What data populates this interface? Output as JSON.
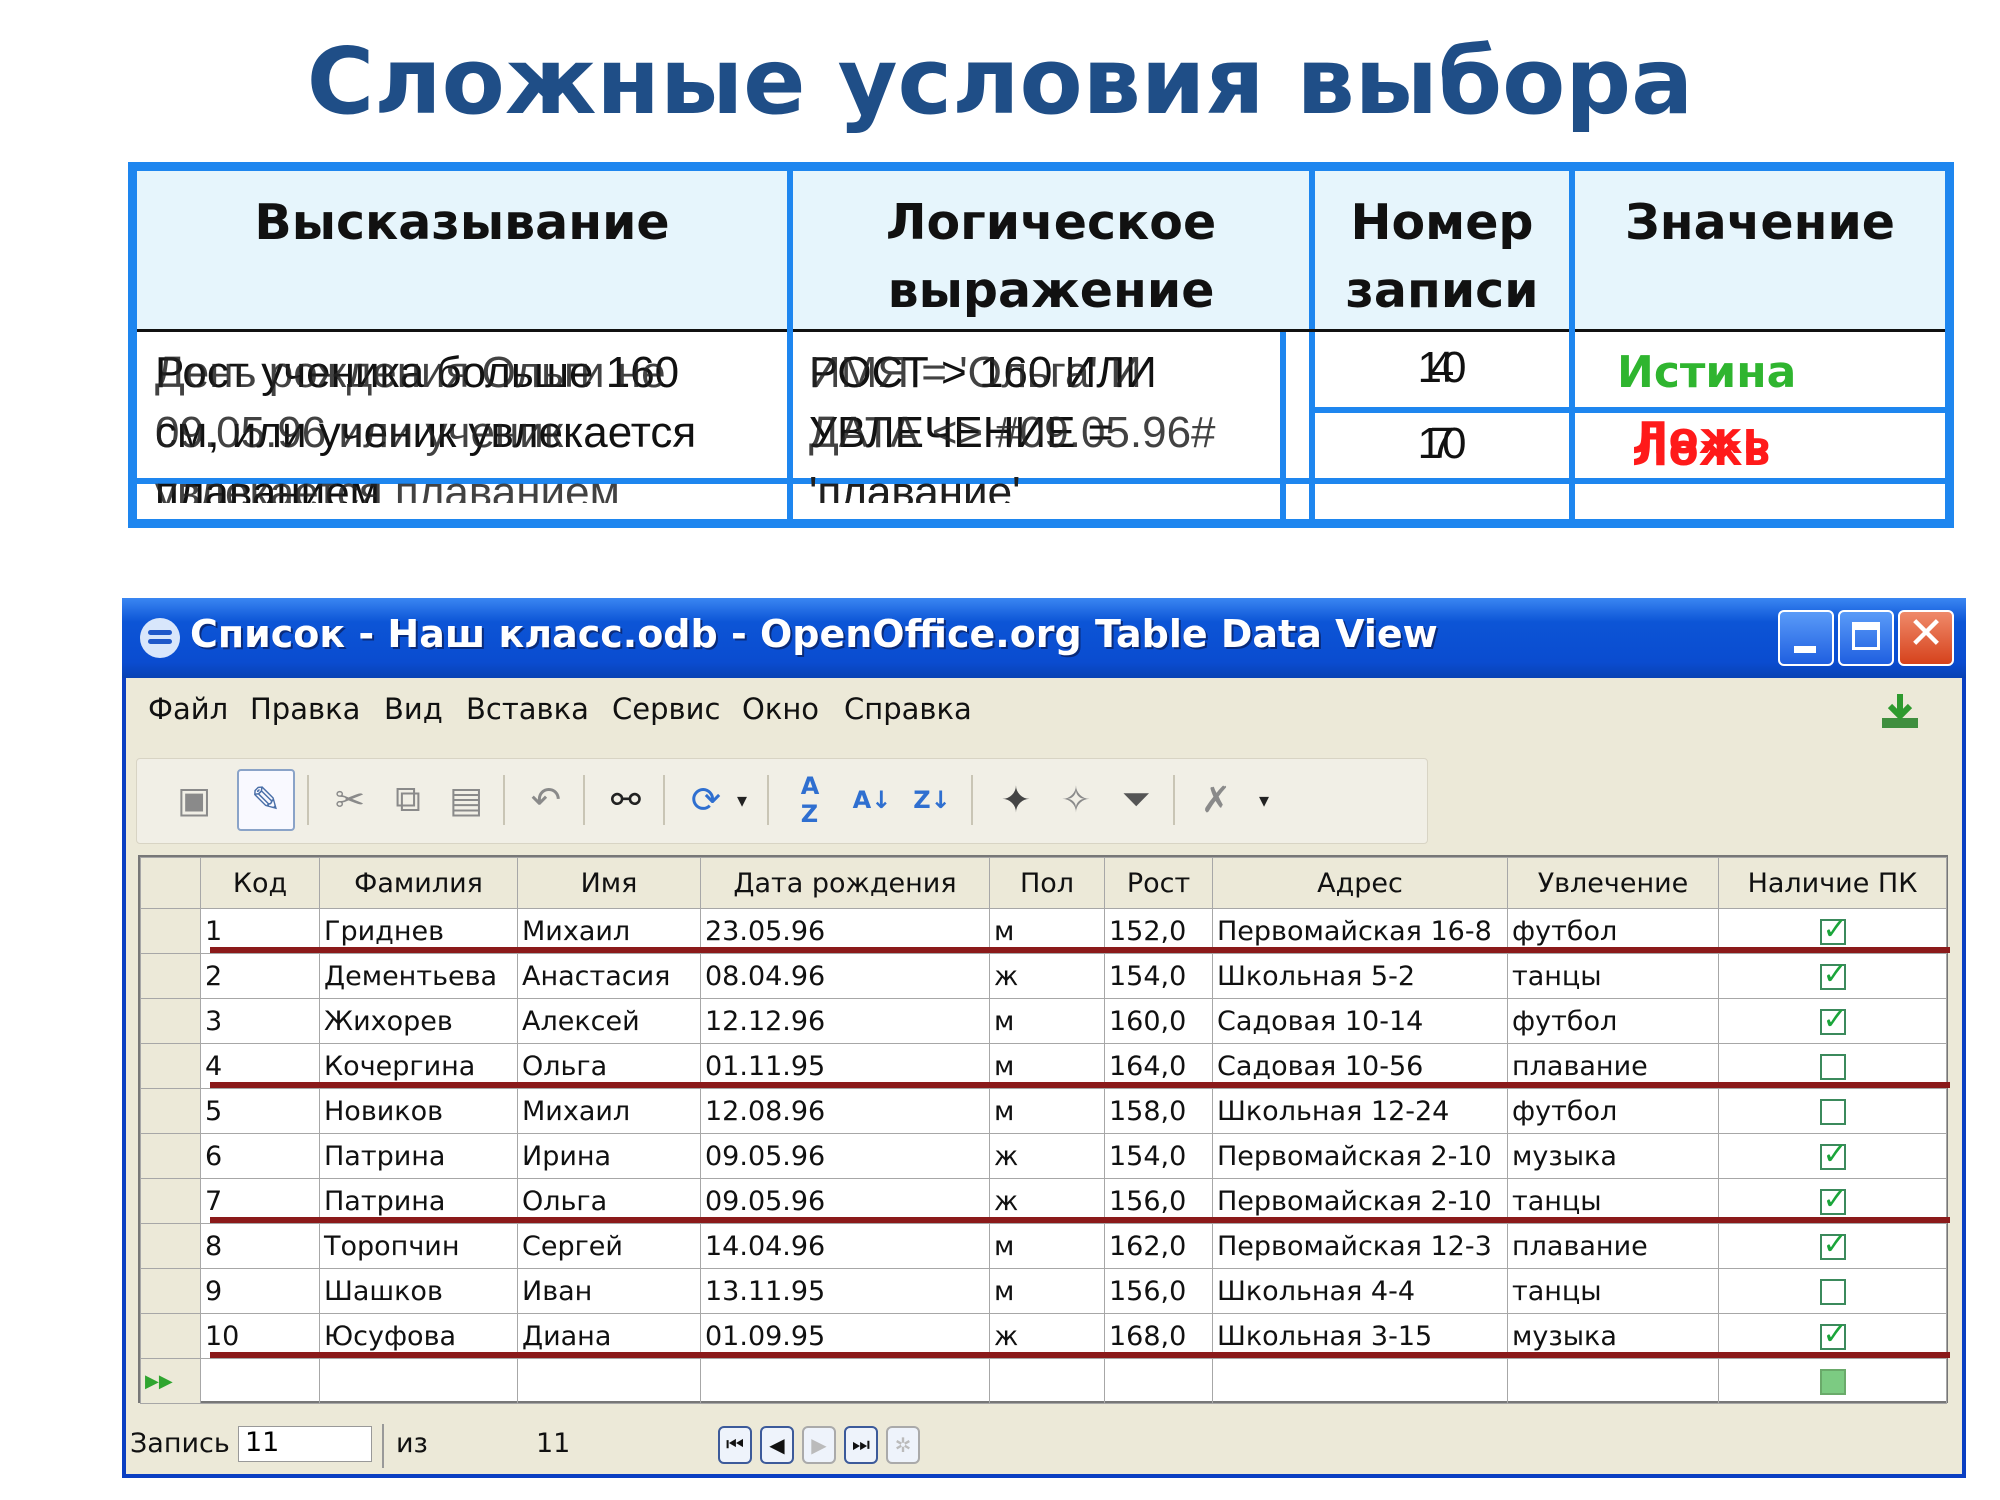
{
  "slide": {
    "title": "Сложные условия выбора"
  },
  "conditions_table": {
    "headers": [
      "Высказывание",
      "Логическое выражение",
      "Номер записи",
      "Значение"
    ],
    "rows": [
      {
        "statement": [
          "Рост ученика больше 160",
          "см, или ученик увлекается",
          "плаванием"
        ],
        "statement_overlay": [
          "День рождения Ольги не",
          "09.05.96 или ученик",
          "увлекается плаванием"
        ],
        "expression": [
          "РОСТ > 160 ИЛИ",
          "УВЛЕЧЕНИЕ =",
          "'плавание'"
        ],
        "expression_overlay": [
          "ИМЯ = 'Ольга' И",
          "ДАТА <> #09.05.96#",
          "'плавание'"
        ],
        "record_numbers": [
          "4",
          "10"
        ],
        "value": "Истина",
        "value_color": "#2fb52f"
      },
      {
        "record_numbers": [
          "7",
          "10"
        ],
        "value": "Ложь",
        "value_overlay": "Ложь",
        "value_color": "#ff1a1a"
      }
    ]
  },
  "window": {
    "title": "Список - Наш класс.odb - OpenOffice.org Table Data View",
    "menu": [
      "Файл",
      "Правка",
      "Вид",
      "Вставка",
      "Сервис",
      "Окно",
      "Справка"
    ],
    "toolbar_icons": [
      "save-icon",
      "edit-icon",
      "cut-icon",
      "copy-icon",
      "paste-icon",
      "undo-icon",
      "find-icon",
      "refresh-icon",
      "dropdown-arrow-icon",
      "sort-icon",
      "sort-ascending-icon",
      "sort-descending-icon",
      "autofilter-icon",
      "standard-filter-icon",
      "filter-icon",
      "remove-filter-icon",
      "more-icon"
    ],
    "table": {
      "columns": [
        "Код",
        "Фамилия",
        "Имя",
        "Дата рождения",
        "Пол",
        "Рост",
        "Адрес",
        "Увлечение",
        "Наличие ПК"
      ],
      "rows": [
        [
          "1",
          "Гриднев",
          "Михаил",
          "23.05.96",
          "м",
          "152,0",
          "Первомайская 16-8",
          "футбол",
          true
        ],
        [
          "2",
          "Дементьева",
          "Анастасия",
          "08.04.96",
          "ж",
          "154,0",
          "Школьная 5-2",
          "танцы",
          true
        ],
        [
          "3",
          "Жихорев",
          "Алексей",
          "12.12.96",
          "м",
          "160,0",
          "Садовая 10-14",
          "футбол",
          true
        ],
        [
          "4",
          "Кочергина",
          "Ольга",
          "01.11.95",
          "м",
          "164,0",
          "Садовая 10-56",
          "плавание",
          false
        ],
        [
          "5",
          "Новиков",
          "Михаил",
          "12.08.96",
          "м",
          "158,0",
          "Школьная 12-24",
          "футбол",
          false
        ],
        [
          "6",
          "Патрина",
          "Ирина",
          "09.05.96",
          "ж",
          "154,0",
          "Первомайская 2-10",
          "музыка",
          true
        ],
        [
          "7",
          "Патрина",
          "Ольга",
          "09.05.96",
          "ж",
          "156,0",
          "Первомайская 2-10",
          "танцы",
          true
        ],
        [
          "8",
          "Торопчин",
          "Сергей",
          "14.04.96",
          "м",
          "162,0",
          "Первомайская 12-3",
          "плавание",
          true
        ],
        [
          "9",
          "Шашков",
          "Иван",
          "13.11.95",
          "м",
          "156,0",
          "Школьная 4-4",
          "танцы",
          false
        ],
        [
          "10",
          "Юсуфова",
          "Диана",
          "01.09.95",
          "ж",
          "168,0",
          "Школьная 3-15",
          "музыка",
          true
        ]
      ]
    },
    "status": {
      "record_label": "Запись",
      "record_value": "11",
      "of_label": "из",
      "total": "11"
    }
  }
}
